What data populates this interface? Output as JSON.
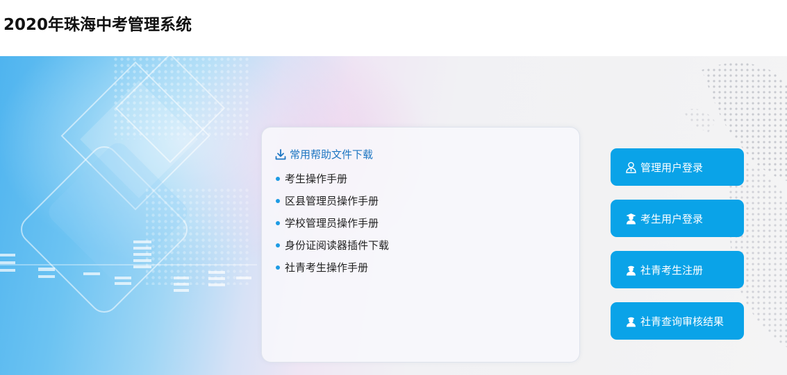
{
  "page": {
    "title": "2020年珠海中考管理系统"
  },
  "help": {
    "heading": "常用帮助文件下载",
    "heading_icon": "download-icon",
    "items": [
      {
        "label": "考生操作手册"
      },
      {
        "label": "区县管理员操作手册"
      },
      {
        "label": "学校管理员操作手册"
      },
      {
        "label": "身份证阅读器插件下载"
      },
      {
        "label": "社青考生操作手册"
      }
    ]
  },
  "actions": [
    {
      "label": "管理用户登录",
      "icon": "admin-user-icon"
    },
    {
      "label": "考生用户登录",
      "icon": "student-user-icon"
    },
    {
      "label": "社青考生注册",
      "icon": "social-student-icon"
    },
    {
      "label": "社青查询审核结果",
      "icon": "social-query-icon"
    }
  ],
  "colors": {
    "accent": "#0aa3e8",
    "link": "#1d76c2",
    "bullet": "#1d9be4"
  }
}
